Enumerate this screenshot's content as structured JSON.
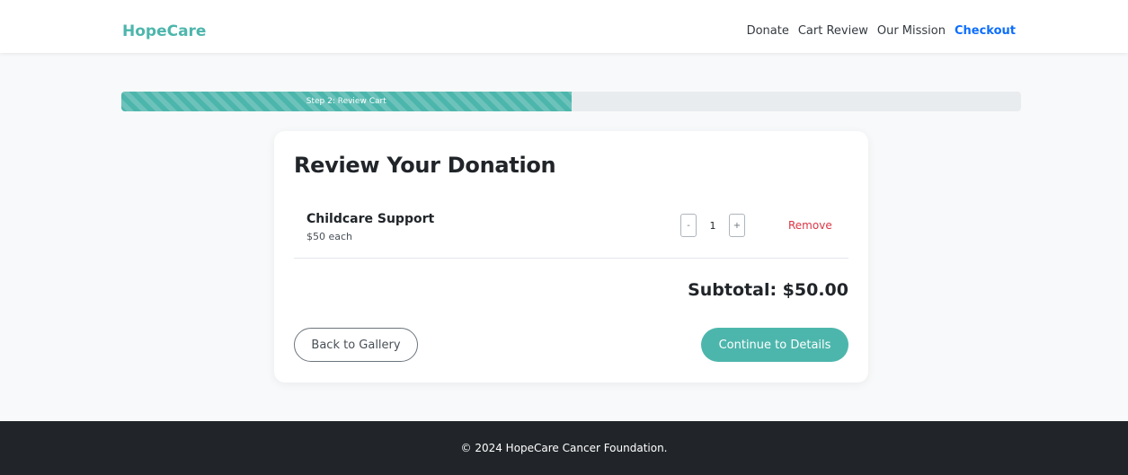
{
  "colors": {
    "brand": "#4db6ac",
    "active_link": "#0d6efd",
    "remove": "#dc3545",
    "footer_bg": "#212529"
  },
  "navbar": {
    "brand": "HopeCare",
    "links": [
      {
        "label": "Donate",
        "active": false
      },
      {
        "label": "Cart Review",
        "active": false
      },
      {
        "label": "Our Mission",
        "active": false
      },
      {
        "label": "Checkout",
        "active": true
      }
    ]
  },
  "progress": {
    "label": "Step 2: Review Cart",
    "percent": 50
  },
  "cart": {
    "title": "Review Your Donation",
    "items": [
      {
        "name": "Childcare Support",
        "price_text": "$50 each",
        "quantity": "1",
        "decrement_label": "-",
        "increment_label": "+",
        "remove_label": "Remove"
      }
    ],
    "subtotal_text": "Subtotal: $50.00",
    "back_label": "Back to Gallery",
    "continue_label": "Continue to Details"
  },
  "footer": {
    "text": "© 2024 HopeCare Cancer Foundation."
  }
}
